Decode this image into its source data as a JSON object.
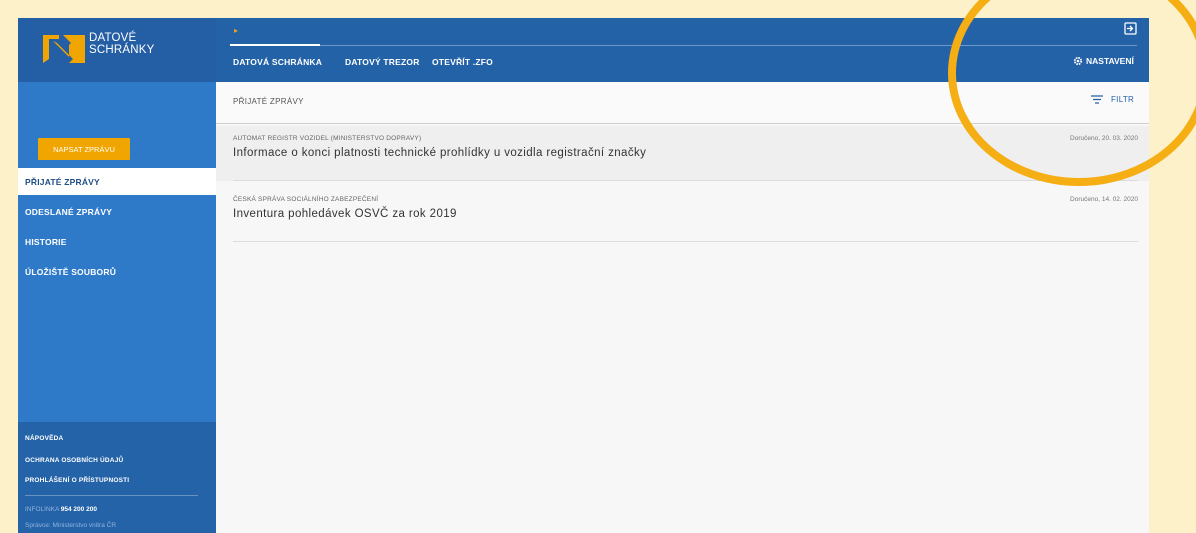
{
  "brand": {
    "line1": "DATOVÉ",
    "line2": "SCHRÁNKY",
    "accent": "#f0a500",
    "primary": "#2462a8"
  },
  "header": {
    "crumb": "▸",
    "tabs": [
      {
        "label": "DATOVÁ SCHRÁNKA"
      },
      {
        "label": "DATOVÝ TREZOR"
      },
      {
        "label": "OTEVŘÍT .ZFO"
      }
    ],
    "settings_label": "NASTAVENÍ",
    "logout_icon": "logout-icon",
    "settings_icon": "gear-icon"
  },
  "sidebar": {
    "compose_label": "NAPSAT ZPRÁVU",
    "items": [
      {
        "label": "PŘIJATÉ ZPRÁVY",
        "active": true
      },
      {
        "label": "ODESLANÉ ZPRÁVY"
      },
      {
        "label": "HISTORIE"
      },
      {
        "label": "ÚLOŽIŠTĚ SOUBORŮ"
      }
    ],
    "footer": {
      "links": [
        "NÁPOVĚDA",
        "OCHRANA OSOBNÍCH ÚDAJŮ",
        "PROHLÁŠENÍ O PŘÍSTUPNOSTI"
      ],
      "info_label": "INFOLINKA",
      "info_number": "954 200 200",
      "admin": "Správce: Ministerstvo vnitra ČR"
    }
  },
  "main": {
    "list_title": "PŘIJATÉ ZPRÁVY",
    "filter_label": "FILTR",
    "messages": [
      {
        "sender": "AUTOMAT REGISTR VOZIDEL (MINISTERSTVO DOPRAVY)",
        "subject": "Informace o konci platnosti technické prohlídky u vozidla registrační značky",
        "date": "Doručeno, 20. 03. 2020"
      },
      {
        "sender": "ČESKÁ SPRÁVA SOCIÁLNÍHO ZABEZPEČENÍ",
        "subject": "Inventura pohledávek OSVČ za rok 2019",
        "date": "Doručeno, 14. 02. 2020"
      }
    ]
  }
}
